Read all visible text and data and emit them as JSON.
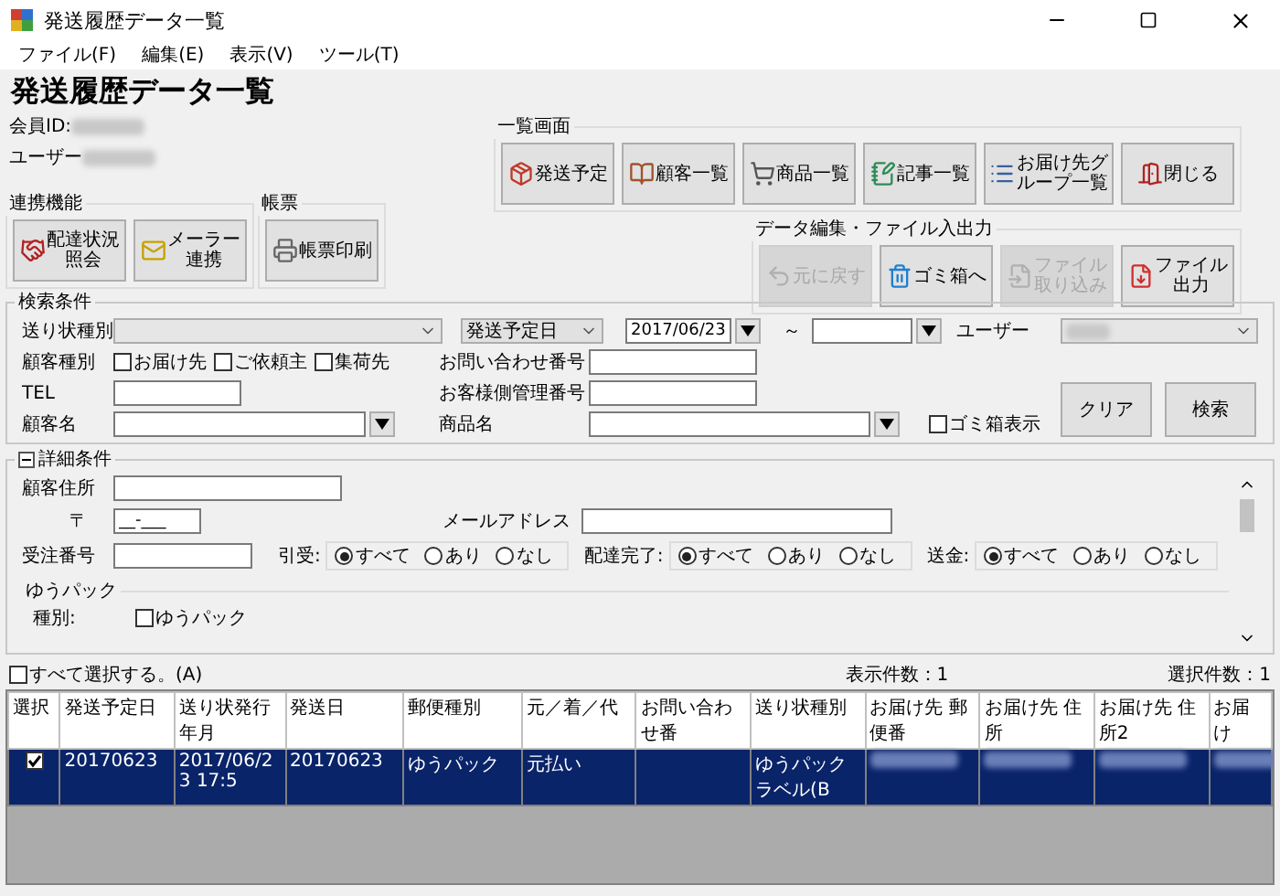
{
  "window": {
    "title": "発送履歴データ一覧"
  },
  "menu": [
    {
      "label": "ファイル(F)"
    },
    {
      "label": "編集(E)"
    },
    {
      "label": "表示(V)"
    },
    {
      "label": "ツール(T)"
    }
  ],
  "heading": "発送履歴データ一覧",
  "account": [
    {
      "label": "会員ID:"
    },
    {
      "label": "ユーザー"
    }
  ],
  "groups": [
    {
      "title": "一覧画面",
      "buttons": [
        {
          "lines": [
            "発送予定"
          ],
          "disabled": false
        },
        {
          "lines": [
            "顧客一覧"
          ],
          "disabled": false
        },
        {
          "lines": [
            "商品一覧"
          ],
          "disabled": false
        },
        {
          "lines": [
            "記事一覧"
          ],
          "disabled": false
        },
        {
          "lines": [
            "お届け先グ",
            "ループ一覧"
          ],
          "disabled": false
        },
        {
          "lines": [
            "閉じる"
          ],
          "disabled": false
        }
      ]
    },
    {
      "title": "連携機能",
      "buttons": [
        {
          "lines": [
            "配達状況",
            "照会"
          ],
          "disabled": false
        },
        {
          "lines": [
            "メーラー",
            "連携"
          ],
          "disabled": false
        }
      ]
    },
    {
      "title": "帳票",
      "buttons": [
        {
          "lines": [
            "帳票印刷"
          ],
          "disabled": false
        }
      ]
    },
    {
      "title": "データ編集・ファイル入出力",
      "buttons": [
        {
          "lines": [
            "元に戻す"
          ],
          "disabled": true
        },
        {
          "lines": [
            "ゴミ箱へ"
          ],
          "disabled": false
        },
        {
          "lines": [
            "ファイル",
            "取り込み"
          ],
          "disabled": true
        },
        {
          "lines": [
            "ファイル",
            "出力"
          ],
          "disabled": false
        }
      ]
    }
  ],
  "search": {
    "title": "検索条件",
    "invoice_type": {
      "label": "送り状種別"
    },
    "date_type": {
      "value": "発送予定日"
    },
    "date_from": {
      "value": "2017/06/23"
    },
    "range_mark": "～",
    "user": {
      "label": "ユーザー"
    },
    "customer_type": {
      "label": "顧客種別",
      "options": [
        {
          "label": "お届け先",
          "checked": false
        },
        {
          "label": "ご依頼主",
          "checked": false
        },
        {
          "label": "集荷先",
          "checked": false
        }
      ]
    },
    "inquiry_no": {
      "label": "お問い合わせ番号"
    },
    "tel": {
      "label": "TEL"
    },
    "customer_mgmt_no": {
      "label": "お客様側管理番号"
    },
    "customer_name": {
      "label": "顧客名"
    },
    "product_name": {
      "label": "商品名"
    },
    "trash": {
      "label": "ゴミ箱表示",
      "checked": false
    },
    "buttons": [
      {
        "label": "クリア"
      },
      {
        "label": "検索"
      }
    ]
  },
  "details": {
    "title": "詳細条件",
    "expanded": true,
    "address": {
      "label": "顧客住所"
    },
    "zip": {
      "label": "〒",
      "value": "__-___"
    },
    "email": {
      "label": "メールアドレス"
    },
    "order_no": {
      "label": "受注番号"
    },
    "radio_groups": [
      {
        "label": "引受:",
        "options": [
          {
            "label": "すべて",
            "selected": true
          },
          {
            "label": "あり",
            "selected": false
          },
          {
            "label": "なし",
            "selected": false
          }
        ]
      },
      {
        "label": "配達完了:",
        "options": [
          {
            "label": "すべて",
            "selected": true
          },
          {
            "label": "あり",
            "selected": false
          },
          {
            "label": "なし",
            "selected": false
          }
        ]
      },
      {
        "label": "送金:",
        "options": [
          {
            "label": "すべて",
            "selected": true
          },
          {
            "label": "あり",
            "selected": false
          },
          {
            "label": "なし",
            "selected": false
          }
        ]
      }
    ],
    "yupack": {
      "title": "ゆうパック",
      "label": "種別:",
      "option": {
        "label": "ゆうパック",
        "checked": false
      }
    }
  },
  "list": {
    "select_all": {
      "label": "すべて選択する。(A)",
      "checked": false
    },
    "display_count": "表示件数：1",
    "selected_count": "選択件数：1",
    "columns": [
      "選択",
      "発送予定日",
      "送り状発行年月",
      "発送日",
      "郵便種別",
      "元／着／代",
      "お問い合わせ番",
      "送り状種別",
      "お届け先 郵便番",
      "お届け先 住所",
      "お届け先 住所2",
      "お届け"
    ],
    "rows": [
      {
        "selected": true,
        "cells": [
          {
            "kind": "check",
            "checked": true
          },
          {
            "kind": "text",
            "text": "20170623"
          },
          {
            "kind": "text",
            "text": "2017/06/23 17:5"
          },
          {
            "kind": "text",
            "text": "20170623"
          },
          {
            "kind": "text",
            "text": "ゆうパック"
          },
          {
            "kind": "text",
            "text": "元払い"
          },
          {
            "kind": "empty"
          },
          {
            "kind": "text",
            "text": "ゆうパックラベル(B"
          },
          {
            "kind": "redacted"
          },
          {
            "kind": "redacted"
          },
          {
            "kind": "redacted"
          },
          {
            "kind": "redacted"
          }
        ]
      }
    ]
  }
}
